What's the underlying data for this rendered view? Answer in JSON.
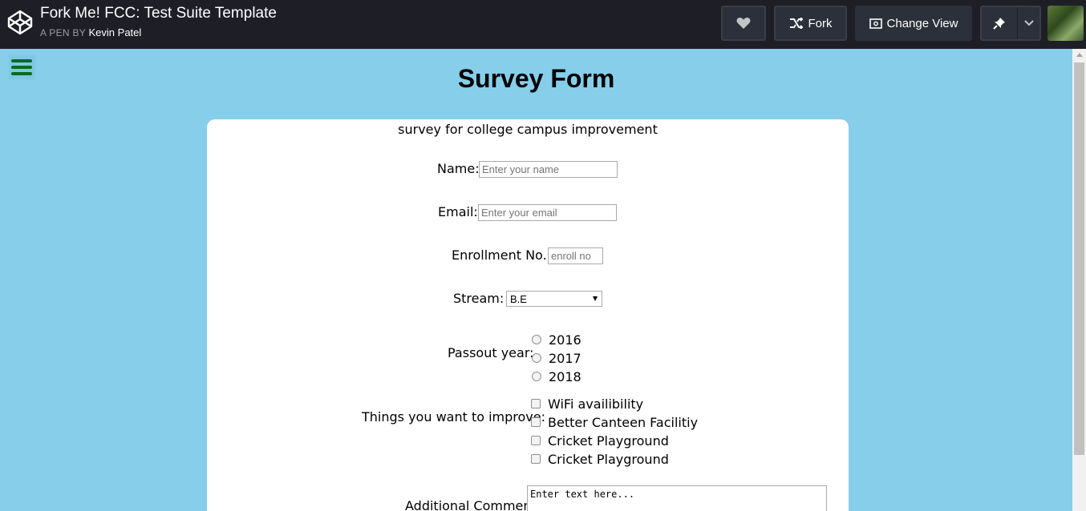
{
  "header": {
    "title": "Fork Me! FCC: Test Suite Template",
    "by_label": "A PEN BY",
    "author": "Kevin Patel",
    "fork_label": "Fork",
    "change_view_label": "Change View"
  },
  "icons": {
    "logo": "codepen-logo-icon",
    "heart": "heart-icon",
    "fork": "fork-icon",
    "view": "change-view-icon",
    "pin": "pin-icon",
    "chevron": "chevron-down-icon",
    "menu": "hamburger-menu-icon"
  },
  "colors": {
    "page_background": "#87ceeb",
    "topbar": "#1e1f26",
    "menu_icon": "#0b6b1f"
  },
  "form": {
    "heading": "Survey Form",
    "description": "survey for college campus improvement",
    "name_label": "Name:",
    "name_placeholder": "Enter your name",
    "email_label": "Email:",
    "email_placeholder": "Enter your email",
    "enroll_label": "Enrollment No.:",
    "enroll_placeholder": "enroll no",
    "stream_label": "Stream:",
    "stream_value": "B.E",
    "passout_label": "Passout year:",
    "years": [
      "2016",
      "2017",
      "2018"
    ],
    "improve_label": "Things you want to improve:",
    "improvements": [
      "WiFi availibility",
      "Better Canteen Facilitiy",
      "Cricket Playground",
      "Cricket Playground"
    ],
    "comment_label": "Additional Comment:",
    "comment_placeholder": "Enter text here..."
  }
}
